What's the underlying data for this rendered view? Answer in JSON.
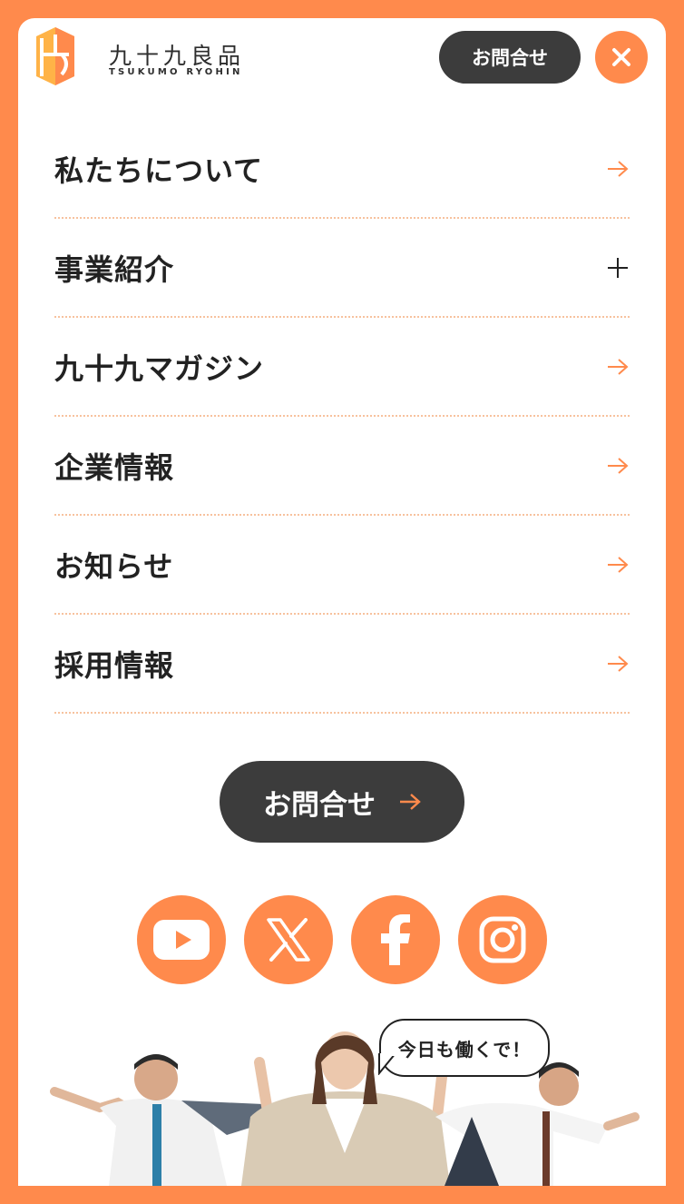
{
  "brand": {
    "name_ja": "九十九良品",
    "name_en": "TSUKUMO RYOHIN",
    "accent": "#FF8A4C",
    "dark": "#3C3C3C"
  },
  "header": {
    "contact_label": "お問合せ",
    "close_icon": "close-icon"
  },
  "nav": {
    "items": [
      {
        "label": "私たちについて",
        "icon": "arrow-right-icon"
      },
      {
        "label": "事業紹介",
        "icon": "plus-icon"
      },
      {
        "label": "九十九マガジン",
        "icon": "arrow-right-icon"
      },
      {
        "label": "企業情報",
        "icon": "arrow-right-icon"
      },
      {
        "label": "お知らせ",
        "icon": "arrow-right-icon"
      },
      {
        "label": "採用情報",
        "icon": "arrow-right-icon"
      }
    ]
  },
  "contact_button": {
    "label": "お問合せ"
  },
  "socials": [
    "youtube-icon",
    "x-icon",
    "facebook-icon",
    "instagram-icon"
  ],
  "illustration": {
    "speech": "今日も働くで！"
  }
}
